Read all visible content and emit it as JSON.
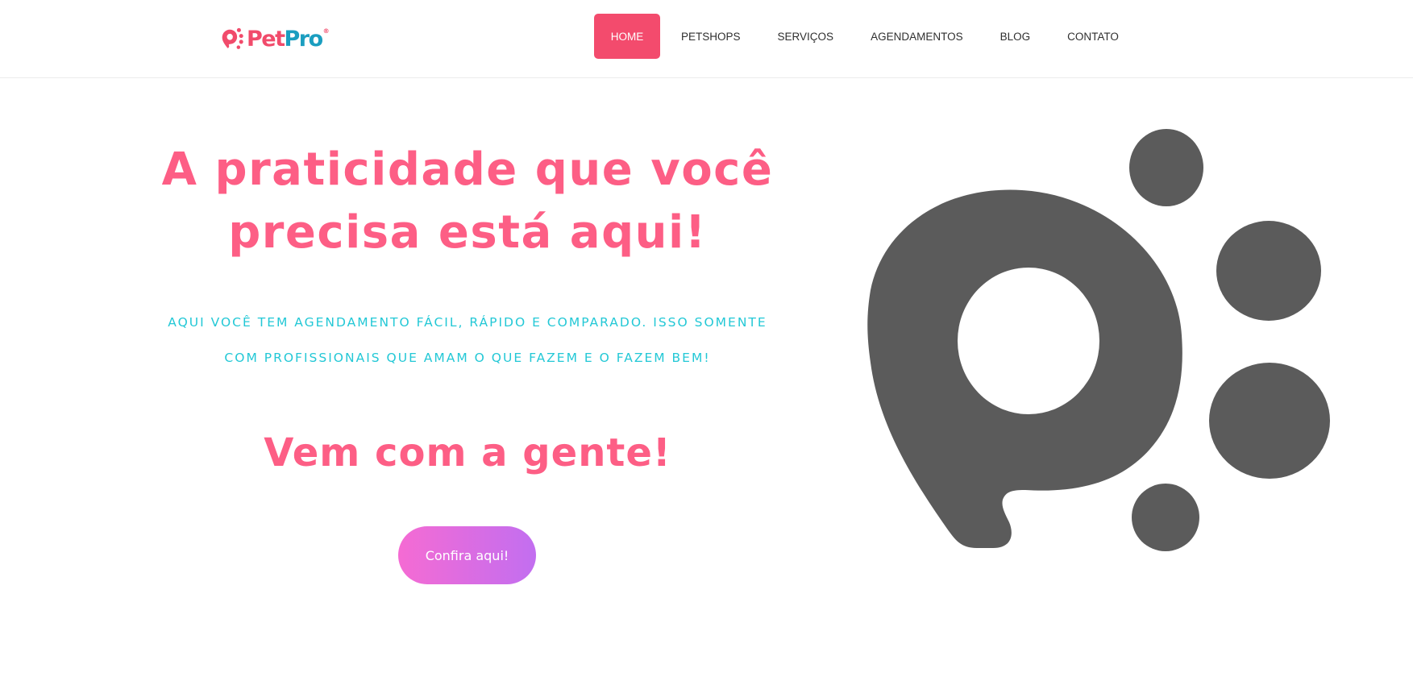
{
  "brand": {
    "name_part1": "Pet",
    "name_part2": "Pro",
    "registered": "®",
    "colors": {
      "pink": "#f14b6b",
      "teal": "#1b9ec0"
    }
  },
  "nav": {
    "items": [
      {
        "label": "HOME",
        "active": true
      },
      {
        "label": "PETSHOPS",
        "active": false
      },
      {
        "label": "SERVIÇOS",
        "active": false
      },
      {
        "label": "AGENDAMENTOS",
        "active": false
      },
      {
        "label": "BLOG",
        "active": false
      },
      {
        "label": "CONTATO",
        "active": false
      }
    ],
    "active_color": "#f34b6d"
  },
  "hero": {
    "title_line1": "A praticidade que você",
    "title_line2": "precisa está aqui!",
    "subtitle_line1": "AQUI VOCÊ TEM AGENDAMENTO FÁCIL, RÁPIDO E COMPARADO. ISSO SOMENTE",
    "subtitle_line2": "COM PROFISSIONAIS QUE AMAM O QUE FAZEM E O FAZEM BEM!",
    "tagline": "Vem com a gente!",
    "button_label": "Confira aqui!",
    "graphic": "petpro-paw-logo-icon",
    "colors": {
      "title": "#fd5e85",
      "subtitle": "#23c8d6",
      "graphic": "#5b5b5b",
      "button_gradient": [
        "#f56bd3",
        "#c26ef0"
      ]
    }
  }
}
